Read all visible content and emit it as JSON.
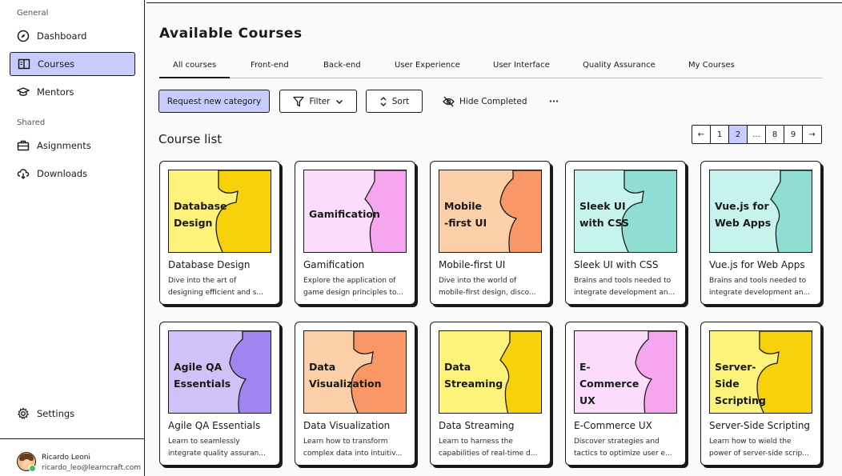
{
  "sidebar": {
    "general_label": "General",
    "shared_label": "Shared",
    "items": [
      {
        "label": "Dashboard",
        "icon": "compass-icon"
      },
      {
        "label": "Courses",
        "icon": "book-icon"
      },
      {
        "label": "Mentors",
        "icon": "graduation-cap-icon"
      },
      {
        "label": "Asignments",
        "icon": "briefcase-icon"
      },
      {
        "label": "Downloads",
        "icon": "cloud-download-icon"
      },
      {
        "label": "Settings",
        "icon": "gear-icon"
      }
    ],
    "user": {
      "name": "Ricardo Leoni",
      "email": "ricardo_leo@learncraft.com"
    }
  },
  "main": {
    "title": "Available Courses",
    "tabs": [
      "All courses",
      "Front-end",
      "Back-end",
      "User Experience",
      "User Interface",
      "Quality Assurance",
      "My Courses"
    ],
    "toolbar": {
      "request_label": "Request new category",
      "filter_label": "Filter",
      "sort_label": "Sort",
      "hide_completed_label": "Hide Completed",
      "more_label": "···"
    },
    "section_title": "Course list",
    "pagination": [
      "1",
      "2",
      "...",
      "8",
      "9"
    ],
    "pagination_prev": "←",
    "pagination_next": "→",
    "courses": [
      {
        "thumb_line1": "Database",
        "thumb_line2": "Design",
        "title": "Database Design",
        "desc1": "Dive into the art of",
        "desc2": "designing efficient and s...",
        "bg": "#fdf37a",
        "accent": "#f7d20a"
      },
      {
        "thumb_line1": "Gamification",
        "thumb_line2": "",
        "title": "Gamification",
        "desc1": "Explore the application of",
        "desc2": "game design principles to...",
        "bg": "#fcdcfb",
        "accent": "#f6a5ef"
      },
      {
        "thumb_line1": "Mobile",
        "thumb_line2": "-first UI",
        "title": "Mobile-first UI",
        "desc1": "Dive into the world of",
        "desc2": "mobile-first design, disco...",
        "bg": "#fbcfa7",
        "accent": "#fa9766"
      },
      {
        "thumb_line1": "Sleek UI",
        "thumb_line2": "with CSS",
        "title": "Sleek UI with CSS",
        "desc1": "Brains and tools needed to",
        "desc2": "integrate development an...",
        "bg": "#c7f3ed",
        "accent": "#8fddd3"
      },
      {
        "thumb_line1": "Vue.js for",
        "thumb_line2": "Web Apps",
        "title": "Vue.js for Web Apps",
        "desc1": "Brains and tools needed to",
        "desc2": "integrate development an...",
        "bg": "#c7f3ed",
        "accent": "#8fddd3"
      },
      {
        "thumb_line1": "Agile QA",
        "thumb_line2": "Essentials",
        "title": "Agile QA Essentials",
        "desc1": "Learn to seamlessly",
        "desc2": "integrate quality assuran...",
        "bg": "#cfc2f7",
        "accent": "#a084f0"
      },
      {
        "thumb_line1": "Data",
        "thumb_line2": "Visualization",
        "title": "Data Visualization",
        "desc1": "Learn how to transform",
        "desc2": "complex data into intuitiv...",
        "bg": "#fbcfa7",
        "accent": "#fa9766"
      },
      {
        "thumb_line1": "Data",
        "thumb_line2": "Streaming",
        "title": "Data Streaming",
        "desc1": "Learn to harness the",
        "desc2": "capabilities of real-time d...",
        "bg": "#fdf37a",
        "accent": "#f7d20a"
      },
      {
        "thumb_line1": "E-Commerce",
        "thumb_line2": "UX strategy",
        "title": "E-Commerce UX",
        "desc1": "Discover strategies and",
        "desc2": "tactics to optimize user e...",
        "bg": "#fcdcfb",
        "accent": "#f6a5ef"
      },
      {
        "thumb_line1": "Server-Side",
        "thumb_line2": "Scripting",
        "title": "Server-Side Scripting",
        "desc1": "Learn how to wield the",
        "desc2": "power of server-side scrip...",
        "bg": "#fdf37a",
        "accent": "#f7d20a"
      }
    ]
  }
}
